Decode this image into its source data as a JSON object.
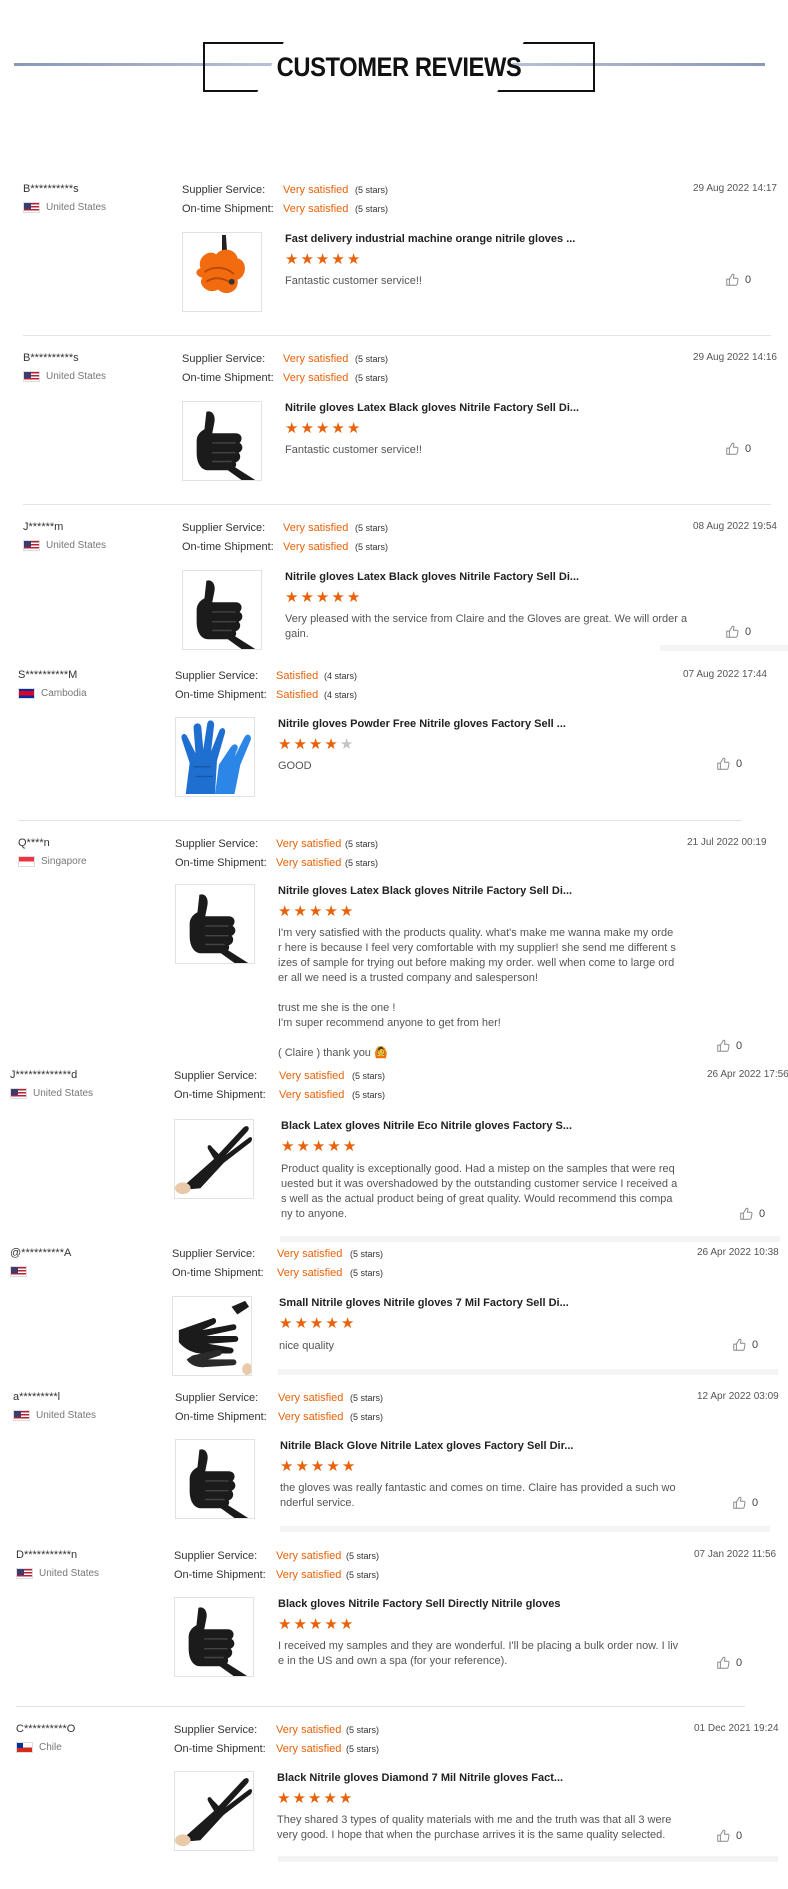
{
  "header": {
    "title": "CUSTOMER REVIEWS"
  },
  "labels": {
    "supplier_service": "Supplier Service:",
    "ontime_shipment": "On-time Shipment:"
  },
  "reviews": [
    {
      "buyer": "B**********s",
      "country": "United States",
      "flag": "us",
      "supplier_rating": "Very satisfied",
      "supplier_stars": "(5 stars)",
      "shipment_rating": "Very satisfied",
      "shipment_stars": "(5 stars)",
      "date": "29 Aug 2022 14:17",
      "product_title": "Fast delivery industrial machine orange nitrile gloves ...",
      "product_image": "orange-glove",
      "star_count": 5,
      "comment": "Fantastic customer service!!",
      "likes": "0"
    },
    {
      "buyer": "B**********s",
      "country": "United States",
      "flag": "us",
      "supplier_rating": "Very satisfied",
      "supplier_stars": "(5 stars)",
      "shipment_rating": "Very satisfied",
      "shipment_stars": "(5 stars)",
      "date": "29 Aug 2022 14:16",
      "product_title": "Nitrile gloves Latex Black gloves Nitrile Factory Sell Di...",
      "product_image": "black-glove-thumbs-up",
      "star_count": 5,
      "comment": "Fantastic customer service!!",
      "likes": "0"
    },
    {
      "buyer": "J******m",
      "country": "United States",
      "flag": "us",
      "supplier_rating": "Very satisfied",
      "supplier_stars": "(5 stars)",
      "shipment_rating": "Very satisfied",
      "shipment_stars": "(5 stars)",
      "date": "08 Aug 2022 19:54",
      "product_title": "Nitrile gloves Latex Black gloves Nitrile Factory Sell Di...",
      "product_image": "black-glove-thumbs-up",
      "star_count": 5,
      "comment": "Very pleased with the service from Claire and the Gloves are great. We will order a\ngain.",
      "likes": "0"
    },
    {
      "buyer": "S**********M",
      "country": "Cambodia",
      "flag": "kh",
      "supplier_rating": "Satisfied",
      "supplier_stars": "(4 stars)",
      "shipment_rating": "Satisfied",
      "shipment_stars": "(4 stars)",
      "date": "07 Aug 2022 17:44",
      "product_title": "Nitrile gloves Powder Free Nitrile gloves Factory Sell ...",
      "product_image": "blue-gloves",
      "star_count": 4,
      "comment": "GOOD",
      "likes": "0"
    },
    {
      "buyer": "Q****n",
      "country": "Singapore",
      "flag": "sg",
      "supplier_rating": "Very satisfied",
      "supplier_stars": "(5 stars)",
      "shipment_rating": "Very satisfied",
      "shipment_stars": "(5 stars)",
      "date": "21 Jul 2022 00:19",
      "product_title": "Nitrile gloves Latex Black gloves Nitrile Factory Sell Di...",
      "product_image": "black-glove-thumbs-up",
      "star_count": 5,
      "comment": "I'm very satisfied with the products quality. what's make me wanna make my orde\nr here is because I feel very comfortable with my supplier! she send me different s\nizes of sample for trying out before making my order. well when come to large ord\ner all we need is a trusted company and salesperson!\n\ntrust me she is the one !\nI'm super recommend anyone to get from her!\n\n( Claire ) thank you 🙆",
      "likes": "0"
    },
    {
      "buyer": "J*************d",
      "country": "United States",
      "flag": "us",
      "supplier_rating": "Very satisfied",
      "supplier_stars": "(5 stars)",
      "shipment_rating": "Very satisfied",
      "shipment_stars": "(5 stars)",
      "date": "26 Apr 2022 17:56",
      "product_title": "Black Latex gloves Nitrile Eco Nitrile gloves Factory S...",
      "product_image": "black-glove-diagonal",
      "star_count": 5,
      "comment": "Product quality is exceptionally good. Had a mistep on the samples that were req\nuested but it was overshadowed by the outstanding customer service I received a\ns well as the actual product being of great quality. Would recommend this compa\nny to anyone.",
      "likes": "0"
    },
    {
      "buyer": "@**********A",
      "country": "",
      "flag": "us",
      "supplier_rating": "Very satisfied",
      "supplier_stars": "(5 stars)",
      "shipment_rating": "Very satisfied",
      "shipment_stars": "(5 stars)",
      "date": "26 Apr 2022 10:38",
      "product_title": "Small Nitrile gloves Nitrile gloves 7 Mil Factory Sell Di...",
      "product_image": "black-gloves-pair",
      "star_count": 5,
      "comment": "nice quality",
      "likes": "0"
    },
    {
      "buyer": "a*********l",
      "country": "United States",
      "flag": "us",
      "supplier_rating": "Very satisfied",
      "supplier_stars": "(5 stars)",
      "shipment_rating": "Very satisfied",
      "shipment_stars": "(5 stars)",
      "date": "12 Apr 2022 03:09",
      "product_title": "Nitrile Black Glove Nitrile Latex gloves Factory Sell Dir...",
      "product_image": "black-glove-thumbs-up",
      "star_count": 5,
      "comment": "the gloves was really fantastic and comes on time. Claire has provided a such wo\nnderful service.",
      "likes": "0"
    },
    {
      "buyer": "D***********n",
      "country": "United States",
      "flag": "us",
      "supplier_rating": "Very satisfied",
      "supplier_stars": "(5 stars)",
      "shipment_rating": "Very satisfied",
      "shipment_stars": "(5 stars)",
      "date": "07 Jan 2022 11:56",
      "product_title": "Black gloves Nitrile Factory Sell Directly Nitrile gloves",
      "product_image": "black-glove-thumbs-up",
      "star_count": 5,
      "comment": "I received my samples and they are wonderful. I'll be placing a bulk order now. I liv\ne in the US and own a spa (for your reference).",
      "likes": "0"
    },
    {
      "buyer": "C**********O",
      "country": "Chile",
      "flag": "cl",
      "supplier_rating": "Very satisfied",
      "supplier_stars": "(5 stars)",
      "shipment_rating": "Very satisfied",
      "shipment_stars": "(5 stars)",
      "date": "01 Dec 2021 19:24",
      "product_title": "Black Nitrile gloves Diamond 7 Mil Nitrile gloves Fact...",
      "product_image": "black-glove-diagonal",
      "star_count": 5,
      "comment": "They shared 3 types of quality materials with me and the truth was that all 3 were\nvery good. I hope that when the purchase arrives it is the same quality selected.",
      "likes": "0"
    }
  ]
}
